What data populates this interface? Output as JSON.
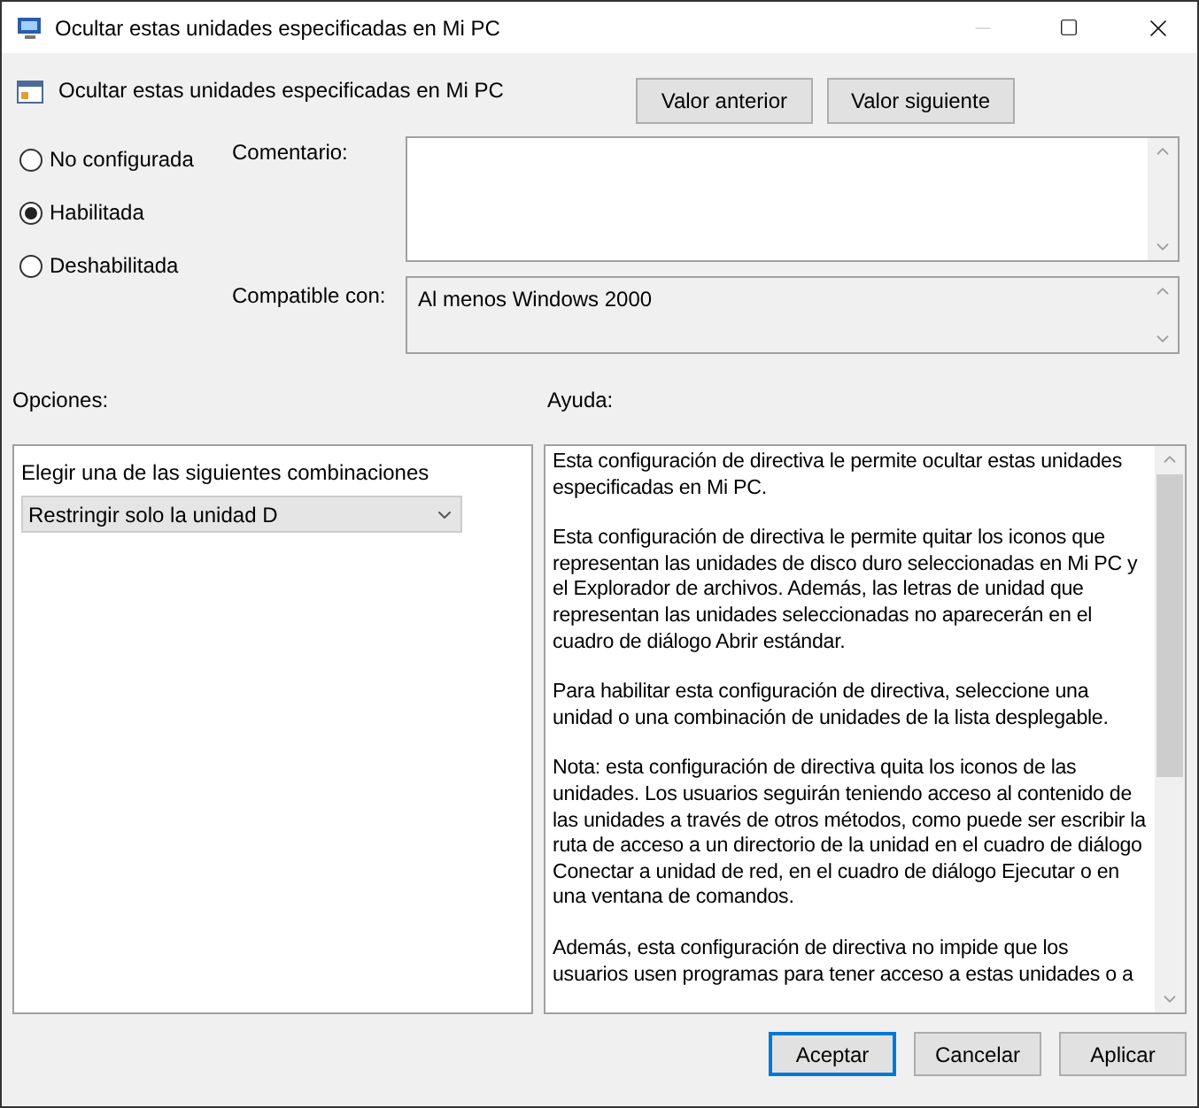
{
  "window": {
    "title": "Ocultar estas unidades especificadas en Mi PC"
  },
  "policy": {
    "title": "Ocultar estas unidades especificadas en Mi PC",
    "nav_buttons": [
      "Valor anterior",
      "Valor siguiente"
    ]
  },
  "state_options": [
    {
      "label": "No configurada",
      "selected": false
    },
    {
      "label": "Habilitada",
      "selected": true
    },
    {
      "label": "Deshabilitada",
      "selected": false
    }
  ],
  "comment": {
    "label": "Comentario:"
  },
  "compatible": {
    "label": "Compatible con:",
    "value": "Al menos Windows 2000"
  },
  "options": {
    "label": "Opciones:",
    "prompt": "Elegir una de las siguientes combinaciones",
    "dropdown": "Restringir solo la unidad D"
  },
  "help": {
    "label": "Ayuda:",
    "paragraphs": [
      "Esta configuración de directiva le permite ocultar estas unidades especificadas en Mi PC.",
      "Esta configuración de directiva le permite quitar los iconos que representan las unidades de disco duro seleccionadas en Mi PC y el Explorador de archivos. Además, las letras de unidad que representan las unidades seleccionadas no aparecerán en el cuadro de diálogo Abrir estándar.",
      "Para habilitar esta configuración de directiva, seleccione una unidad o una combinación de unidades de la lista desplegable.",
      "Nota: esta configuración de directiva quita los iconos de las unidades. Los usuarios seguirán teniendo acceso al contenido de las unidades a través de otros métodos, como puede ser escribir la ruta de acceso a un directorio de la unidad en el cuadro de diálogo Conectar a unidad de red, en el cuadro de diálogo Ejecutar o en una ventana de comandos.",
      "Además, esta configuración de directiva no impide que los usuarios usen programas para tener acceso a estas unidades o a"
    ]
  },
  "buttons": [
    {
      "label": "Aceptar",
      "default": true
    },
    {
      "label": "Cancelar",
      "default": false
    },
    {
      "label": "Aplicar",
      "default": false
    }
  ]
}
